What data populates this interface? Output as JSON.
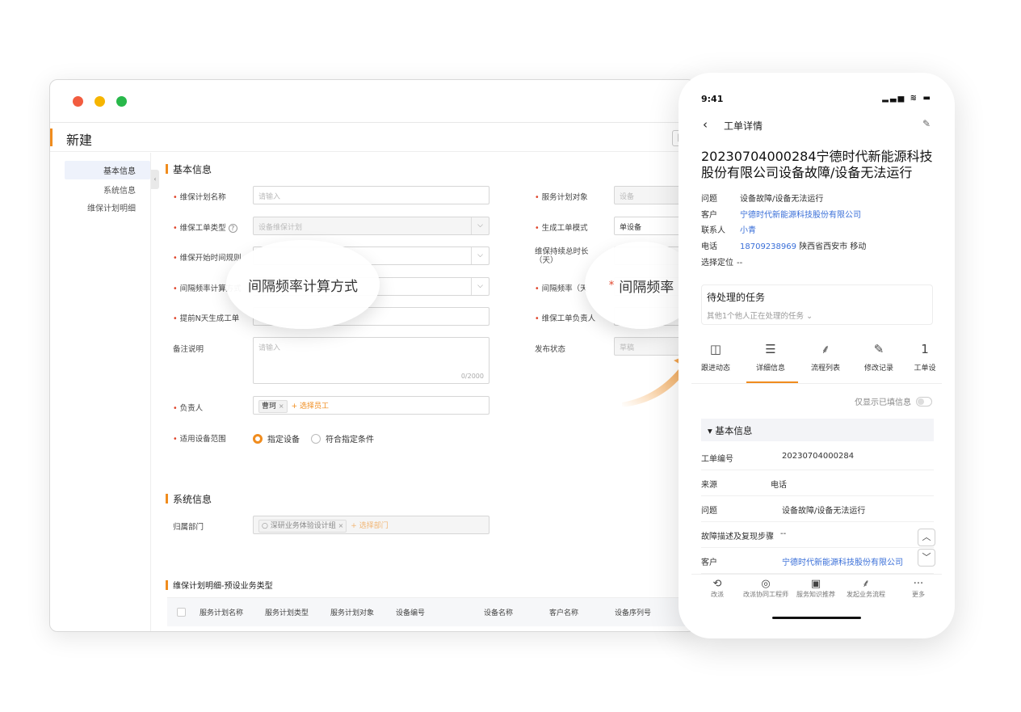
{
  "colors": {
    "accent": "#f08c1e",
    "link": "#3a6fd8",
    "required": "#e0452b",
    "dot_red": "#f25c3f",
    "dot_yellow": "#f6b500",
    "dot_green": "#28b84a"
  },
  "desktop": {
    "title": "新建",
    "nav": [
      "基本信息",
      "系统信息",
      "维保计划明细"
    ],
    "basic": {
      "title": "基本信息",
      "plan_name": {
        "label": "维保计划名称",
        "placeholder": "请输入"
      },
      "service_object": {
        "label": "服务计划对象",
        "placeholder": "设备"
      },
      "ticket_type": {
        "label": "维保工单类型",
        "value": "设备维保计划",
        "help": "?"
      },
      "gen_mode": {
        "label": "生成工单模式",
        "value": "单设备"
      },
      "start_rule": {
        "label": "维保开始时间规则"
      },
      "duration": {
        "label": "维保持续总时长（天）"
      },
      "interval_method": {
        "label": "间隔频率计算方式"
      },
      "interval_freq": {
        "label": "间隔频率（天"
      },
      "advance": {
        "label": "提前N天生成工单"
      },
      "owner_ticket": {
        "label": "维保工单负责人"
      },
      "remark": {
        "label": "备注说明",
        "placeholder": "请输入",
        "count": "0/2000"
      },
      "publish": {
        "label": "发布状态",
        "value": "草稿"
      },
      "owner": {
        "label": "负责人",
        "tag": "曹珂",
        "tag_x": "×",
        "add": "+ 选择员工"
      },
      "scope": {
        "label": "适用设备范围",
        "opt1": "指定设备",
        "opt2": "符合指定条件"
      }
    },
    "system": {
      "title": "系统信息",
      "dept": {
        "label": "归属部门",
        "tag": "○ 深研业务体验设计组",
        "tag_x": "×",
        "add": "+ 选择部门"
      }
    },
    "detail": {
      "title": "维保计划明细-预设业务类型",
      "cols": [
        "服务计划名称",
        "服务计划类型",
        "服务计划对象",
        "设备编号",
        "设备名称",
        "客户名称",
        "设备序列号"
      ]
    },
    "magnifier1": "间隔频率计算方式",
    "magnifier2": {
      "star": "*",
      "text": "间隔频率"
    }
  },
  "phone": {
    "time": "9:41",
    "status_icons": "▂▃▅ ≋ ▬",
    "nav_title": "工单详情",
    "ticket_title": "20230704000284宁德时代新能源科技股份有限公司设备故障/设备无法运行",
    "info": [
      {
        "k": "问题",
        "v": "设备故障/设备无法运行"
      },
      {
        "k": "客户",
        "v": "宁德时代新能源科技股份有限公司"
      },
      {
        "k": "联系人",
        "v": "小青"
      },
      {
        "k": "电话",
        "v": "18709238969",
        "extra": "陕西省西安市 移动"
      },
      {
        "k": "选择定位",
        "v": "--"
      }
    ],
    "task": {
      "title": "待处理的任务",
      "sub": "其他1个他人正在处理的任务 ⌄"
    },
    "tabs": [
      "跟进动态",
      "详细信息",
      "流程列表",
      "修改记录",
      "工单设"
    ],
    "tab_extra": "1",
    "toggle_label": "仅显示已填信息",
    "group": "▾ 基本信息",
    "rows": [
      {
        "k": "工单编号",
        "v": "20230704000284"
      },
      {
        "k": "来源",
        "v": "电话"
      },
      {
        "k": "问题",
        "v": "设备故障/设备无法运行"
      },
      {
        "k": "故障描述及复现步骤",
        "v": "--"
      },
      {
        "k": "客户",
        "v": "宁德时代新能源科技股份有限公司"
      }
    ],
    "bottom": [
      "改派",
      "改派协同工程师",
      "服务知识推荐",
      "发起业务流程",
      "更多"
    ]
  }
}
